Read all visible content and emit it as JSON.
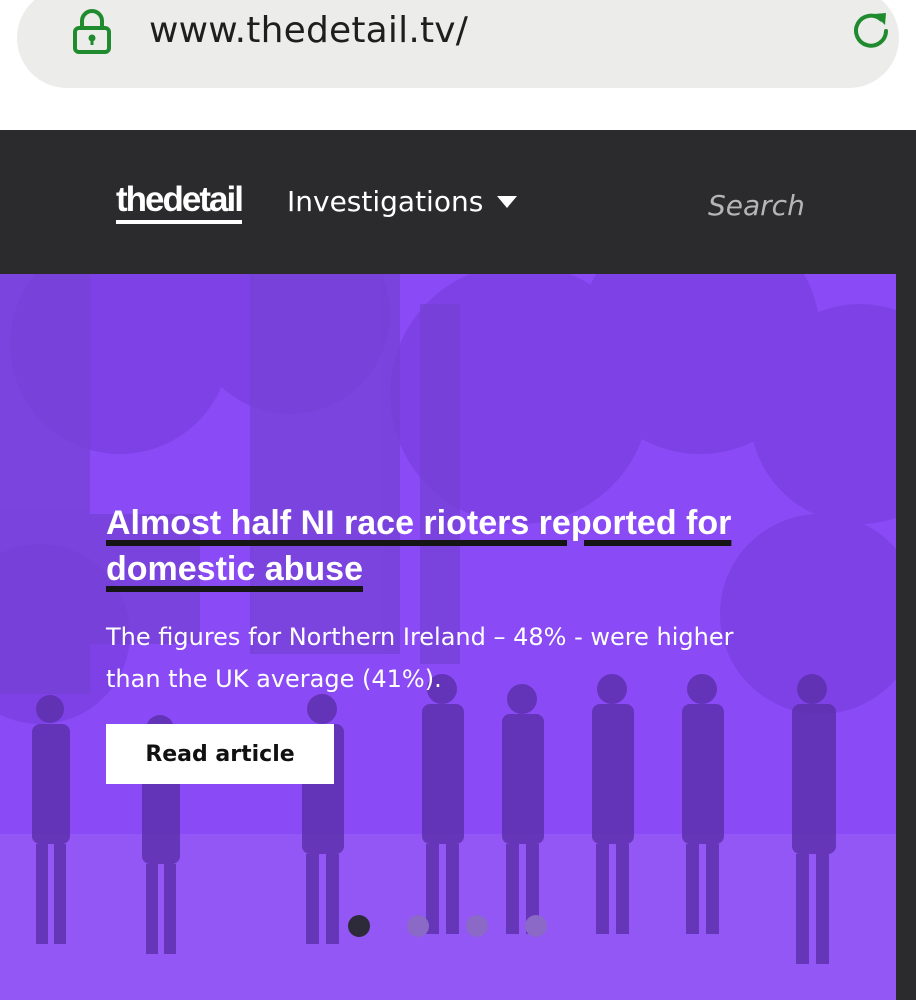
{
  "browser": {
    "url": "www.thedetail.tv/",
    "lock_icon": "lock-icon",
    "reload_icon": "reload-icon",
    "accent_color": "#1f8a2e"
  },
  "header": {
    "logo": "thedetail",
    "nav_label": "Investigations",
    "search_label": "Search",
    "background": "#2b2b2d"
  },
  "hero": {
    "headline": "Almost half NI race rioters reported for domestic abuse",
    "summary": "The figures for Northern Ireland – 48% - were higher than the UK average (41%).",
    "button_label": "Read article",
    "overlay_color": "#8a4af6",
    "carousel": {
      "total": 4,
      "active": 1
    }
  }
}
